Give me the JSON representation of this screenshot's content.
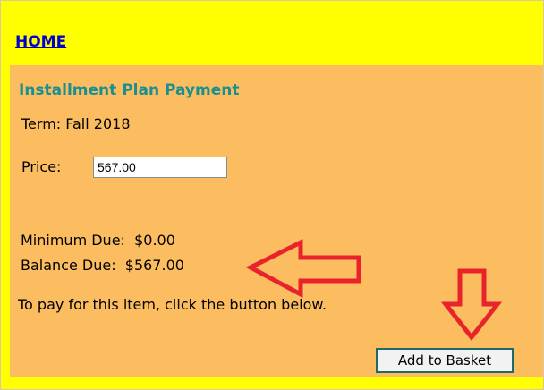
{
  "nav": {
    "home_label": "HOME"
  },
  "form": {
    "title": "Installment Plan Payment",
    "term": "Term: Fall 2018",
    "price_label": "Price:",
    "price_value": "567.00",
    "minimum_due": "Minimum Due:  $0.00",
    "balance_due": "Balance Due:  $567.00",
    "instructions": "To pay for this item, click the button below.",
    "add_button_label": "Add to Basket"
  },
  "annotations": {
    "arrow_color": "#e8232b",
    "arrows": [
      "left-arrow-pointing-to-balance-due",
      "down-arrow-pointing-to-add-to-basket"
    ]
  },
  "colors": {
    "page_bg": "#ffff00",
    "panel_bg": "#fcbd60",
    "title_color": "#1a8f8f",
    "link_color": "#0000cc"
  }
}
